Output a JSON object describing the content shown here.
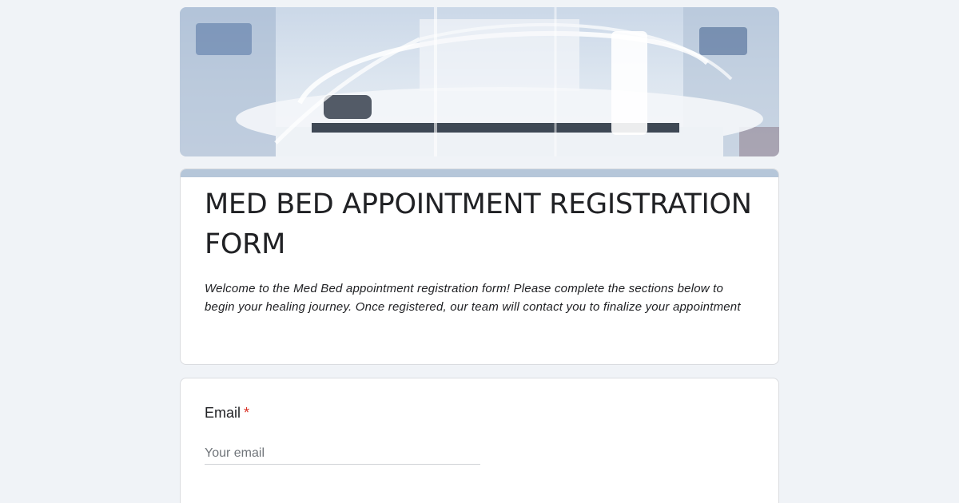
{
  "form": {
    "title": "MED BED APPOINTMENT REGISTRATION FORM",
    "description": "Welcome to the Med Bed appointment registration form! Please complete the sections below to begin your healing journey. Once registered, our team will contact you to finalize your appointment",
    "accent_color": "#b5c6d9",
    "background_color": "#f0f3f7"
  },
  "header_image": {
    "description_icon": "medical-bed-image"
  },
  "questions": [
    {
      "label": "Email",
      "required_mark": "*",
      "placeholder": "Your email",
      "value": ""
    }
  ]
}
